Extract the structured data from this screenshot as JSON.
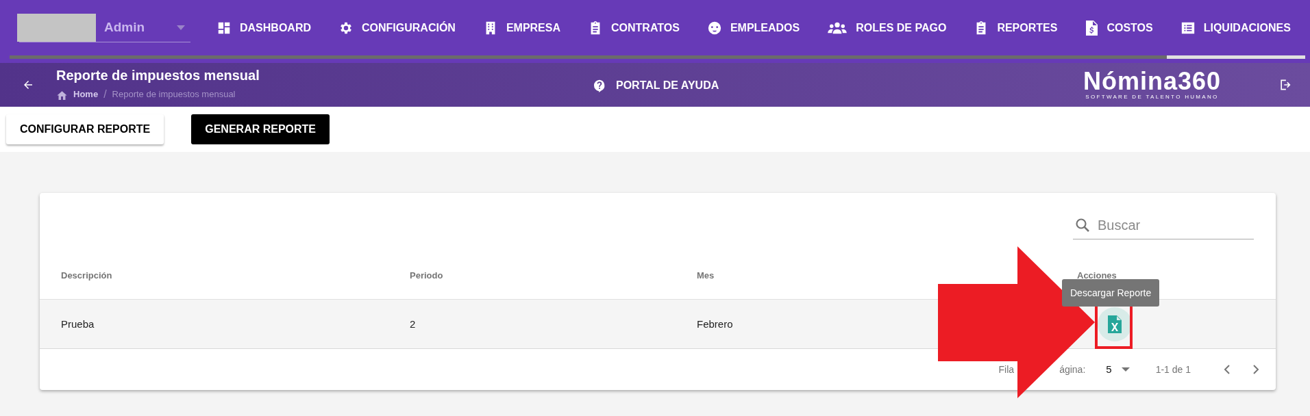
{
  "user_menu": {
    "name": "Admin"
  },
  "nav": [
    {
      "label": "DASHBOARD",
      "selected": false
    },
    {
      "label": "CONFIGURACIÓN",
      "selected": false
    },
    {
      "label": "EMPRESA",
      "selected": false
    },
    {
      "label": "CONTRATOS",
      "selected": false
    },
    {
      "label": "EMPLEADOS",
      "selected": false
    },
    {
      "label": "ROLES DE PAGO",
      "selected": false
    },
    {
      "label": "REPORTES",
      "selected": false
    },
    {
      "label": "COSTOS",
      "selected": false
    },
    {
      "label": "LIQUIDACIONES",
      "selected": true
    }
  ],
  "header": {
    "title": "Reporte de impuestos mensual",
    "breadcrumb": [
      "Home",
      "Reporte de impuestos mensual"
    ],
    "breadcrumb_separator": "/",
    "help": "PORTAL DE AYUDA",
    "logo": "Nómina360",
    "logo_tagline": "SOFTWARE DE TALENTO HUMANO"
  },
  "actions": [
    {
      "label": "CONFIGURAR REPORTE",
      "kind": "outlined"
    },
    {
      "label": "GENERAR REPORTE",
      "kind": "filled"
    }
  ],
  "table": {
    "search": {
      "placeholder": "Buscar"
    },
    "columns": [
      "Descripción",
      "Periodo",
      "Mes",
      "Acciones"
    ],
    "rows": [
      {
        "cells": [
          "Prueba",
          "2",
          "Febrero"
        ],
        "tooltip": "Descargar Reporte"
      }
    ],
    "footer": {
      "rows_per_page_label_parts": [
        "Fila",
        "ágina:"
      ],
      "rows_per_page": "5",
      "range": "1-1 de 1"
    }
  }
}
